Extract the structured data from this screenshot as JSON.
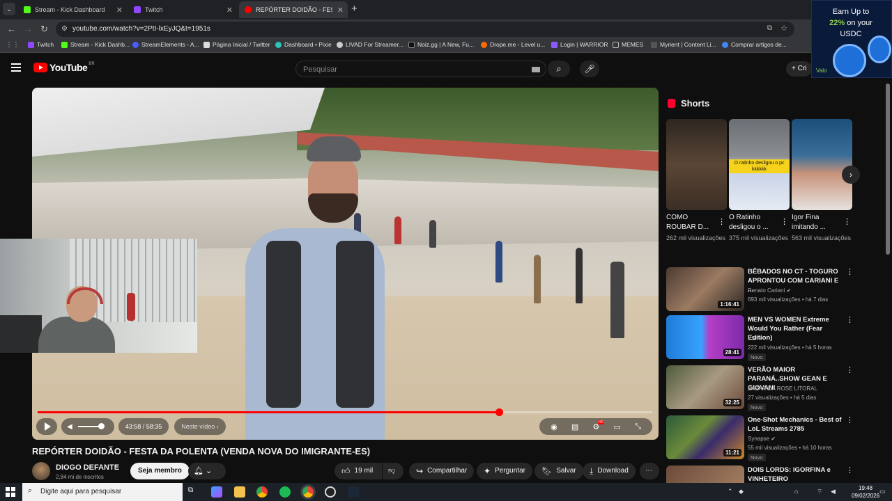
{
  "browser": {
    "tabs": [
      {
        "label": "Stream - Kick Dashboard",
        "color": "#53fc18"
      },
      {
        "label": "Twitch",
        "color": "#9146ff"
      },
      {
        "label": "REPÓRTER DOIDÃO - FESTA DA",
        "color": "#ff0000"
      }
    ],
    "url": "youtube.com/watch?v=2PtI-lxEyJQ&t=1951s",
    "bookmarks": [
      {
        "label": "Twitch",
        "color": "#9146ff"
      },
      {
        "label": "Stream - Kick Dashb...",
        "color": "#53fc18"
      },
      {
        "label": "StreamElements - A...",
        "color": "#4b5cff"
      },
      {
        "label": "Página Inicial / Twitter",
        "color": "#dddddd"
      },
      {
        "label": "Dashboard • Pixie",
        "color": "#2ec4b6"
      },
      {
        "label": "LIVAD For Streamer...",
        "color": "#cccccc"
      },
      {
        "label": "Noiz.gg | A New, Fu...",
        "color": "#111111"
      },
      {
        "label": "Drope.me - Level u...",
        "color": "#ff6a00"
      },
      {
        "label": "Login | WARRIOR",
        "color": "#8a5cff"
      },
      {
        "label": "MEMES",
        "color": "#bbbbbb"
      },
      {
        "label": "Myrient | Content Li...",
        "color": "#555555"
      },
      {
        "label": "Comprar artigos de...",
        "color": "#4285f4"
      }
    ]
  },
  "ad": {
    "line1": "Earn Up to",
    "highlight": "22%",
    "line2": " on your",
    "line3": "USDC",
    "tag": "Valo"
  },
  "youtube": {
    "logo_text": "YouTube",
    "region": "BR",
    "search_placeholder": "Pesquisar",
    "create_label": "+ Cri"
  },
  "player": {
    "time": "43:58 / 58:35",
    "next_label": "Neste vídeo ›",
    "progress": 0.75
  },
  "video": {
    "title": "REPÓRTER DOIDÃO - FESTA DA POLENTA (VENDA NOVA DO IMIGRANTE-ES)",
    "channel": "DIOGO DEFANTE",
    "subscribers": "2,84 mi de inscritos",
    "join_label": "Seja membro",
    "likes": "19 mil",
    "share_label": "Compartilhar",
    "ask_label": "Perguntar",
    "save_label": "Salvar",
    "download_label": "Download"
  },
  "shorts": {
    "heading": "Shorts",
    "items": [
      {
        "title": "COMO ROUBAR D...",
        "views": "262 mil visualizações",
        "color": "#4b3b2e"
      },
      {
        "title": "O Ratinho desligou o ...",
        "views": "375 mil visualizações",
        "color": "#7a7f88",
        "overlay": "O ratinho desligou o pc kkkkkk"
      },
      {
        "title": "Igor Fina imitando ...",
        "views": "563 mil visualizações",
        "color": "#2b5a8a"
      }
    ]
  },
  "recommendations": [
    {
      "title": "BÊBADOS NO CT - TOGURO APRONTOU COM CARIANI E ...",
      "channel": "Renato Cariani",
      "meta": "693 mil visualizações • há 7 dias",
      "duration": "1:16:41",
      "new": "",
      "color": "#5a4436",
      "verified": true
    },
    {
      "title": "MEN VS WOMEN Extreme Would You Rather (Fear Edition)",
      "channel": "KSI",
      "meta": "222 mil visualizações • há 5 horas",
      "duration": "28:41",
      "new": "Novo",
      "color": "#2f79c9",
      "verified": true
    },
    {
      "title": "VERÃO MAIOR PARANÁ..SHOW GEAN E GIOVANI",
      "channel": "BAZAR DA ROSE LITORAL",
      "meta": "27 visualizações • há 5 dias",
      "duration": "32:25",
      "new": "Novo",
      "color": "#6c7a5a",
      "verified": false
    },
    {
      "title": "One-Shot Mechanics - Best of LoL Streams 2785",
      "channel": "Synapse",
      "meta": "55 mil visualizações • há 10 horas",
      "duration": "11:21",
      "new": "Novo",
      "color": "#3a6b4a",
      "verified": true
    },
    {
      "title": "DOIS LORDS: IGORFINA e VINHETEIRO",
      "channel": "",
      "meta": "",
      "duration": "",
      "new": "",
      "color": "#6a4a3a",
      "verified": false
    }
  ],
  "taskbar": {
    "search_placeholder": "Digite aqui para pesquisar",
    "time": "19:48",
    "date": "09/02/2026"
  }
}
